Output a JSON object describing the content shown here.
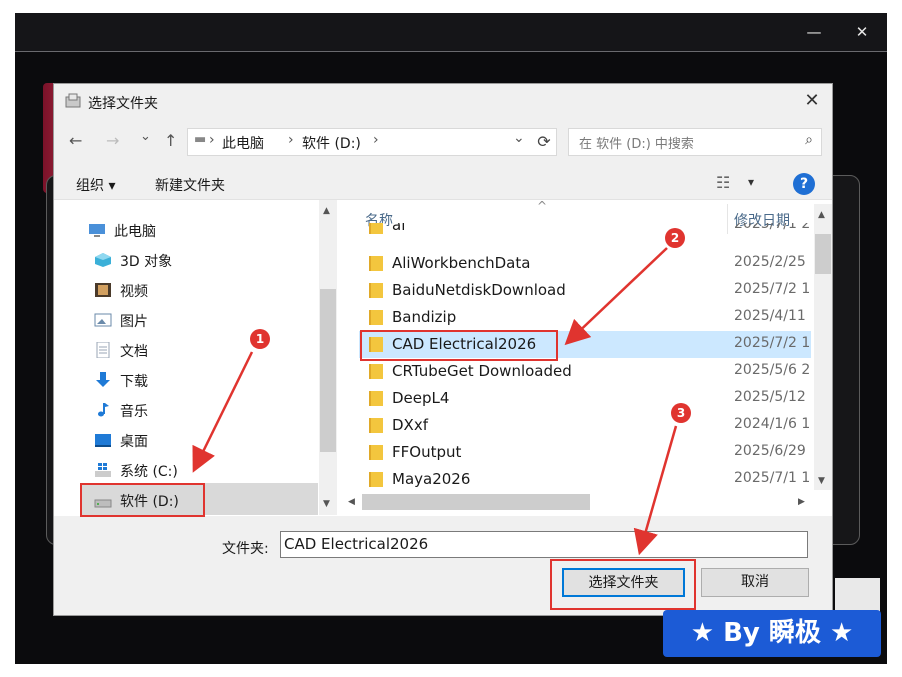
{
  "outer_window": {
    "minimize_label": "—",
    "close_label": "✕"
  },
  "dialog": {
    "title": "选择文件夹",
    "close_label": "✕",
    "nav": {
      "back": "←",
      "forward": "→",
      "recent": "⌄",
      "up": "↑"
    },
    "address": {
      "drive_glyph": "▬",
      "segments": [
        "此电脑",
        "软件 (D:)"
      ],
      "separators": [
        "›",
        "›",
        "›"
      ],
      "dropdown": "⌄",
      "refresh": "⟳"
    },
    "search": {
      "placeholder": "在 软件 (D:) 中搜索",
      "icon": "⌕"
    },
    "toolbar": {
      "organize": "组织 ▾",
      "new_folder": "新建文件夹",
      "view_icon": "☷",
      "view_dropdown": "▾",
      "help": "?"
    },
    "sidebar": {
      "items": [
        {
          "label": "此电脑",
          "icon": "computer-icon",
          "color": "#4a90d9"
        },
        {
          "label": "3D 对象",
          "icon": "cube-icon",
          "color": "#3bb0d8"
        },
        {
          "label": "视频",
          "icon": "film-icon",
          "color": "#6a4a2a"
        },
        {
          "label": "图片",
          "icon": "picture-icon",
          "color": "#6a8aaa"
        },
        {
          "label": "文档",
          "icon": "document-icon",
          "color": "#9aa6b4"
        },
        {
          "label": "下载",
          "icon": "download-icon",
          "color": "#1f7ad6"
        },
        {
          "label": "音乐",
          "icon": "music-icon",
          "color": "#1f7ad6"
        },
        {
          "label": "桌面",
          "icon": "desktop-icon",
          "color": "#1f7ad6"
        },
        {
          "label": "系统 (C:)",
          "icon": "windows-drive-icon",
          "color": "#1f7ad6"
        },
        {
          "label": "软件 (D:)",
          "icon": "drive-icon",
          "color": "#9a9a9a",
          "selected": true
        }
      ],
      "scroll_up": "▲",
      "scroll_down": "▼"
    },
    "columns": {
      "name": "名称",
      "modified": "修改日期",
      "sort_glyph": "^"
    },
    "files": [
      {
        "name": "ai",
        "date": "2025/7/1 2"
      },
      {
        "name": "AliWorkbenchData",
        "date": "2025/2/25"
      },
      {
        "name": "BaiduNetdiskDownload",
        "date": "2025/7/2 1"
      },
      {
        "name": "Bandizip",
        "date": "2025/4/11"
      },
      {
        "name": "CAD Electrical2026",
        "date": "2025/7/2 1",
        "selected": true
      },
      {
        "name": "CRTubeGet Downloaded",
        "date": "2025/5/6 2"
      },
      {
        "name": "DeepL4",
        "date": "2025/5/12"
      },
      {
        "name": "DXxf",
        "date": "2024/1/6 1"
      },
      {
        "name": "FFOutput",
        "date": "2025/6/29"
      },
      {
        "name": "Maya2026",
        "date": "2025/7/1 1"
      }
    ],
    "scroll": {
      "up": "▲",
      "down": "▼",
      "left": "◀",
      "right": "▶"
    },
    "folder_label": "文件夹:",
    "folder_value": "CAD Electrical2026",
    "select_button": "选择文件夹",
    "cancel_button": "取消"
  },
  "annotations": {
    "badges": [
      "1",
      "2",
      "3"
    ],
    "color": "#e0342f"
  },
  "watermark": "★ By 瞬极 ★"
}
